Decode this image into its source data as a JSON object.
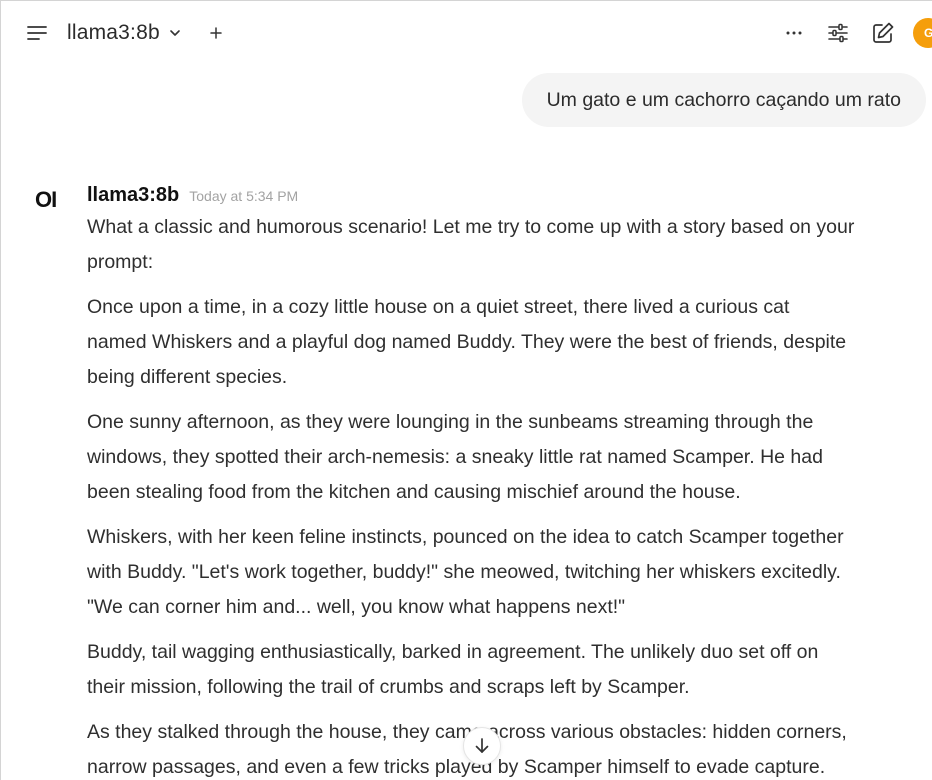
{
  "header": {
    "model_name": "llama3:8b",
    "avatar_initial": "G"
  },
  "user_message": {
    "text": "Um gato e um cachorro caçando um rato"
  },
  "assistant": {
    "logo": "OI",
    "name": "llama3:8b",
    "timestamp": "Today at 5:34 PM",
    "lines": [
      "What a classic and humorous scenario! Let me try to come up with a story based on your",
      "prompt:",
      "Once upon a time, in a cozy little house on a quiet street, there lived a curious cat",
      "named Whiskers and a playful dog named Buddy. They were the best of friends, despite",
      "being different species.",
      "One sunny afternoon, as they were lounging in the sunbeams streaming through the",
      "windows, they spotted their arch-nemesis: a sneaky little rat named Scamper. He had",
      "been stealing food from the kitchen and causing mischief around the house.",
      "Whiskers, with her keen feline instincts, pounced on the idea to catch Scamper together",
      "with Buddy. \"Let's work together, buddy!\" she meowed, twitching her whiskers excitedly.",
      "\"We can corner him and... well, you know what happens next!\"",
      "Buddy, tail wagging enthusiastically, barked in agreement. The unlikely duo set off on",
      "their mission, following the trail of crumbs and scraps left by Scamper.",
      "As they stalked through the house, they came across various obstacles: hidden corners,",
      "narrow passages, and even a few tricks played by Scamper himself to evade capture."
    ]
  },
  "colors": {
    "avatar_bg": "#f59e0b",
    "bubble_bg": "#f4f4f4",
    "timestamp": "#a3a3a3"
  }
}
